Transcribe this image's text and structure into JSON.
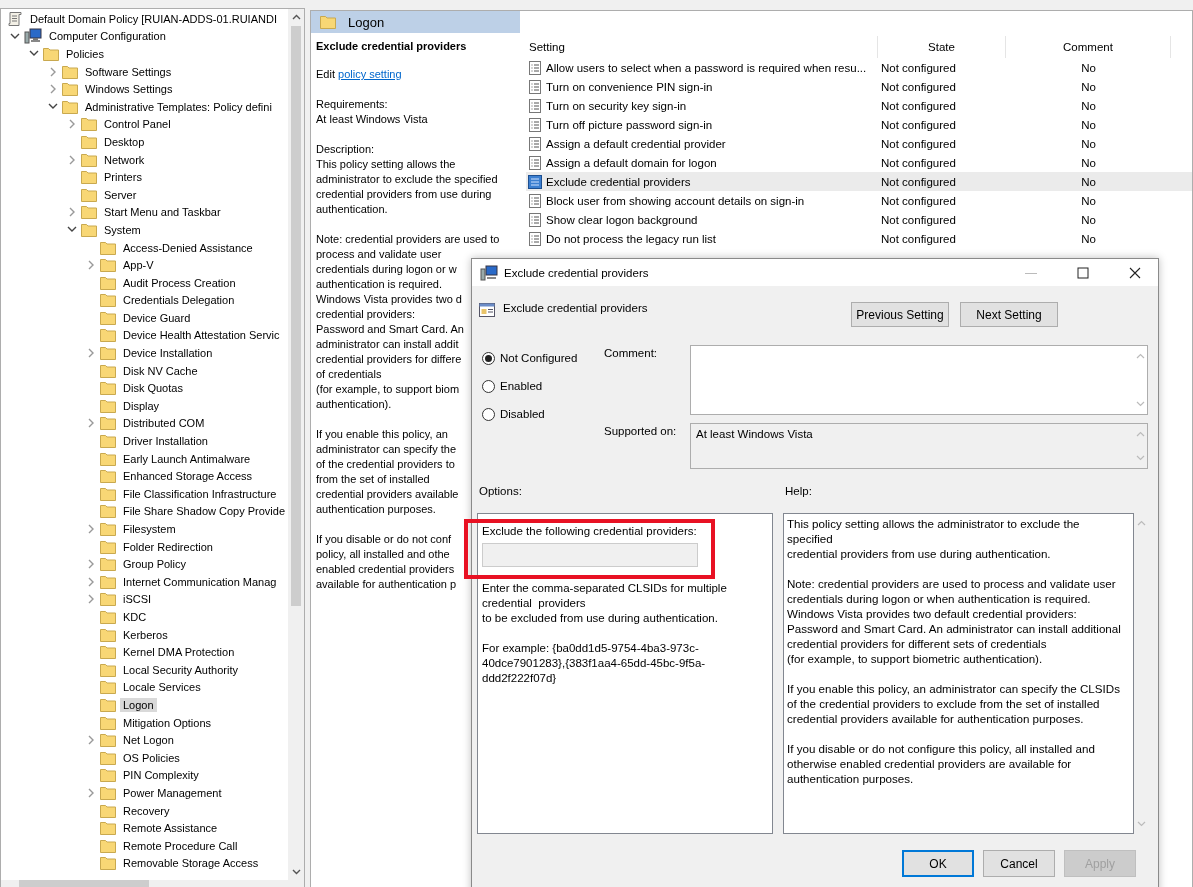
{
  "tree": [
    {
      "label": "Default Domain Policy [RUIAN-ADDS-01.RUIANDI",
      "kind": "policy",
      "selected": false,
      "children": [
        {
          "label": "Computer Configuration",
          "kind": "computer",
          "expanded": true,
          "selected": false,
          "children": [
            {
              "label": "Policies",
              "kind": "folder",
              "expanded": true,
              "selected": false,
              "children": [
                {
                  "label": "Software Settings",
                  "kind": "folder",
                  "expanded": false,
                  "selected": false
                },
                {
                  "label": "Windows Settings",
                  "kind": "folder",
                  "expanded": false,
                  "selected": false
                },
                {
                  "label": "Administrative Templates: Policy defini",
                  "kind": "folder",
                  "expanded": true,
                  "selected": false,
                  "children": [
                    {
                      "label": "Control Panel",
                      "kind": "folder",
                      "expanded": false,
                      "selected": false
                    },
                    {
                      "label": "Desktop",
                      "kind": "folder",
                      "selected": false
                    },
                    {
                      "label": "Network",
                      "kind": "folder",
                      "expanded": false,
                      "selected": false
                    },
                    {
                      "label": "Printers",
                      "kind": "folder",
                      "selected": false
                    },
                    {
                      "label": "Server",
                      "kind": "folder",
                      "selected": false
                    },
                    {
                      "label": "Start Menu and Taskbar",
                      "kind": "folder",
                      "expanded": false,
                      "selected": false
                    },
                    {
                      "label": "System",
                      "kind": "folder",
                      "expanded": true,
                      "selected": false,
                      "children": [
                        {
                          "label": "Access-Denied Assistance",
                          "kind": "folder",
                          "selected": false
                        },
                        {
                          "label": "App-V",
                          "kind": "folder",
                          "expanded": false,
                          "selected": false
                        },
                        {
                          "label": "Audit Process Creation",
                          "kind": "folder",
                          "selected": false
                        },
                        {
                          "label": "Credentials Delegation",
                          "kind": "folder",
                          "selected": false
                        },
                        {
                          "label": "Device Guard",
                          "kind": "folder",
                          "selected": false
                        },
                        {
                          "label": "Device Health Attestation Servic",
                          "kind": "folder",
                          "selected": false
                        },
                        {
                          "label": "Device Installation",
                          "kind": "folder",
                          "expanded": false,
                          "selected": false
                        },
                        {
                          "label": "Disk NV Cache",
                          "kind": "folder",
                          "selected": false
                        },
                        {
                          "label": "Disk Quotas",
                          "kind": "folder",
                          "selected": false
                        },
                        {
                          "label": "Display",
                          "kind": "folder",
                          "selected": false
                        },
                        {
                          "label": "Distributed COM",
                          "kind": "folder",
                          "expanded": false,
                          "selected": false
                        },
                        {
                          "label": "Driver Installation",
                          "kind": "folder",
                          "selected": false
                        },
                        {
                          "label": "Early Launch Antimalware",
                          "kind": "folder",
                          "selected": false
                        },
                        {
                          "label": "Enhanced Storage Access",
                          "kind": "folder",
                          "selected": false
                        },
                        {
                          "label": "File Classification Infrastructure",
                          "kind": "folder",
                          "selected": false
                        },
                        {
                          "label": "File Share Shadow Copy Provide",
                          "kind": "folder",
                          "selected": false
                        },
                        {
                          "label": "Filesystem",
                          "kind": "folder",
                          "expanded": false,
                          "selected": false
                        },
                        {
                          "label": "Folder Redirection",
                          "kind": "folder",
                          "selected": false
                        },
                        {
                          "label": "Group Policy",
                          "kind": "folder",
                          "expanded": false,
                          "selected": false
                        },
                        {
                          "label": "Internet Communication Manag",
                          "kind": "folder",
                          "expanded": false,
                          "selected": false
                        },
                        {
                          "label": "iSCSI",
                          "kind": "folder",
                          "expanded": false,
                          "selected": false
                        },
                        {
                          "label": "KDC",
                          "kind": "folder",
                          "selected": false
                        },
                        {
                          "label": "Kerberos",
                          "kind": "folder",
                          "selected": false
                        },
                        {
                          "label": "Kernel DMA Protection",
                          "kind": "folder",
                          "selected": false
                        },
                        {
                          "label": "Local Security Authority",
                          "kind": "folder",
                          "selected": false
                        },
                        {
                          "label": "Locale Services",
                          "kind": "folder",
                          "selected": false
                        },
                        {
                          "label": "Logon",
                          "kind": "folder",
                          "selected": true
                        },
                        {
                          "label": "Mitigation Options",
                          "kind": "folder",
                          "selected": false
                        },
                        {
                          "label": "Net Logon",
                          "kind": "folder",
                          "expanded": false,
                          "selected": false
                        },
                        {
                          "label": "OS Policies",
                          "kind": "folder",
                          "selected": false
                        },
                        {
                          "label": "PIN Complexity",
                          "kind": "folder",
                          "selected": false
                        },
                        {
                          "label": "Power Management",
                          "kind": "folder",
                          "expanded": false,
                          "selected": false
                        },
                        {
                          "label": "Recovery",
                          "kind": "folder",
                          "selected": false
                        },
                        {
                          "label": "Remote Assistance",
                          "kind": "folder",
                          "selected": false
                        },
                        {
                          "label": "Remote Procedure Call",
                          "kind": "folder",
                          "selected": false
                        },
                        {
                          "label": "Removable Storage Access",
                          "kind": "folder",
                          "selected": false
                        }
                      ]
                    }
                  ]
                }
              ]
            }
          ]
        }
      ]
    }
  ],
  "pane": {
    "title": "Logon"
  },
  "details": {
    "heading": "Exclude credential providers",
    "edit": {
      "prefix": "Edit",
      "link": "policy setting"
    },
    "paragraphs": [
      [
        "Requirements:",
        "At least Windows Vista"
      ],
      [
        "Description:",
        "This policy setting allows the",
        "administrator to exclude the specified",
        "credential providers from use during",
        "authentication."
      ],
      [
        "Note: credential providers are used to",
        "process and validate user",
        "credentials during logon or w",
        "authentication is required.",
        "Windows Vista provides two d",
        "credential providers:",
        "Password and Smart Card. An",
        "administrator can install addit",
        "credential providers for differe",
        "of credentials",
        "(for example, to support biom",
        "authentication)."
      ],
      [
        "If you enable this policy, an",
        "administrator can specify the",
        "of the credential providers to",
        "from the set of installed",
        "credential providers available",
        "authentication purposes."
      ],
      [
        "If you disable or do not conf",
        "policy, all installed and othe",
        "enabled credential providers",
        "available for authentication p"
      ]
    ]
  },
  "table": {
    "columns": [
      "Setting",
      "State",
      "Comment"
    ],
    "rows": [
      {
        "setting": "Allow users to select when a password is required when resu...",
        "state": "Not configured",
        "comment": "No",
        "selected": false
      },
      {
        "setting": "Turn on convenience PIN sign-in",
        "state": "Not configured",
        "comment": "No",
        "selected": false
      },
      {
        "setting": "Turn on security key sign-in",
        "state": "Not configured",
        "comment": "No",
        "selected": false
      },
      {
        "setting": "Turn off picture password sign-in",
        "state": "Not configured",
        "comment": "No",
        "selected": false
      },
      {
        "setting": "Assign a default credential provider",
        "state": "Not configured",
        "comment": "No",
        "selected": false
      },
      {
        "setting": "Assign a default domain for logon",
        "state": "Not configured",
        "comment": "No",
        "selected": false
      },
      {
        "setting": "Exclude credential providers",
        "state": "Not configured",
        "comment": "No",
        "selected": true
      },
      {
        "setting": "Block user from showing account details on sign-in",
        "state": "Not configured",
        "comment": "No",
        "selected": false
      },
      {
        "setting": "Show clear logon background",
        "state": "Not configured",
        "comment": "No",
        "selected": false
      },
      {
        "setting": "Do not process the legacy run list",
        "state": "Not configured",
        "comment": "No",
        "selected": false
      }
    ]
  },
  "dialog": {
    "title": "Exclude credential providers",
    "setting_name": "Exclude credential providers",
    "nav_buttons": [
      "Previous Setting",
      "Next Setting"
    ],
    "options": [
      {
        "label": "Not Configured",
        "selected": true
      },
      {
        "label": "Enabled",
        "selected": false
      },
      {
        "label": "Disabled",
        "selected": false
      }
    ],
    "comment_label": "Comment:",
    "supported_label": "Supported on:",
    "supported_value": "At least Windows Vista",
    "options_label": "Options:",
    "help_label": "Help:",
    "option_field": {
      "label": "Exclude the following credential providers:",
      "disabled": true
    },
    "option_text": [
      [
        "Enter the comma-separated CLSIDs for multiple",
        "credential  providers",
        "to be excluded from use during authentication."
      ],
      [
        "For example: {ba0dd1d5-9754-4ba3-973c-",
        "40dce7901283},{383f1aa4-65dd-45bc-9f5a-",
        "ddd2f222f07d}"
      ]
    ],
    "help": [
      [
        "This policy setting allows the administrator to exclude the",
        "specified",
        "credential providers from use during authentication."
      ],
      [
        "Note: credential providers are used to process and validate user",
        "credentials during logon or when authentication is required.",
        "Windows Vista provides two default credential providers:",
        "Password and Smart Card. An administrator can install additional",
        "credential providers for different sets of credentials",
        "(for example, to support biometric authentication)."
      ],
      [
        "If you enable this policy, an administrator can specify the CLSIDs",
        "of the credential providers to exclude from the set of installed",
        "credential providers available for authentication purposes."
      ],
      [
        "If you disable or do not configure this policy, all installed and",
        "otherwise enabled credential providers are available for",
        "authentication purposes."
      ]
    ],
    "buttons": [
      {
        "label": "OK",
        "default": true,
        "disabled": false
      },
      {
        "label": "Cancel",
        "default": false,
        "disabled": false
      },
      {
        "label": "Apply",
        "default": false,
        "disabled": true
      }
    ]
  }
}
